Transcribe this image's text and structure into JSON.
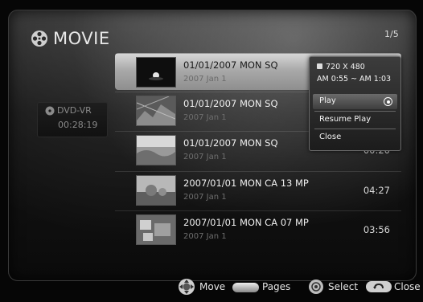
{
  "header": {
    "title": "MOVIE",
    "page_indicator": "1/5"
  },
  "source": {
    "label": "DVD-VR",
    "time": "00:28:19"
  },
  "list": {
    "rows": [
      {
        "title": "01/01/2007 MON    SQ",
        "subtitle": "2007 Jan 1",
        "duration": "",
        "selected": true
      },
      {
        "title": "01/01/2007 MON    SQ",
        "subtitle": "2007 Jan 1",
        "duration": ""
      },
      {
        "title": "01/01/2007 MON    SQ",
        "subtitle": "2007 Jan 1",
        "duration": "00:20"
      },
      {
        "title": "2007/01/01 MON CA 13 MP",
        "subtitle": "2007 Jan 1",
        "duration": "04:27"
      },
      {
        "title": "2007/01/01 MON CA 07 MP",
        "subtitle": "2007 Jan 1",
        "duration": "03:56"
      }
    ]
  },
  "popup": {
    "resolution": "720 X 480",
    "time_range": "AM 0:55 ~ AM 1:03",
    "items": [
      {
        "label": "Play"
      },
      {
        "label": "Resume Play"
      },
      {
        "label": "Close"
      }
    ]
  },
  "footer": {
    "move": "Move",
    "pages": "Pages",
    "select": "Select",
    "close": "Close"
  }
}
